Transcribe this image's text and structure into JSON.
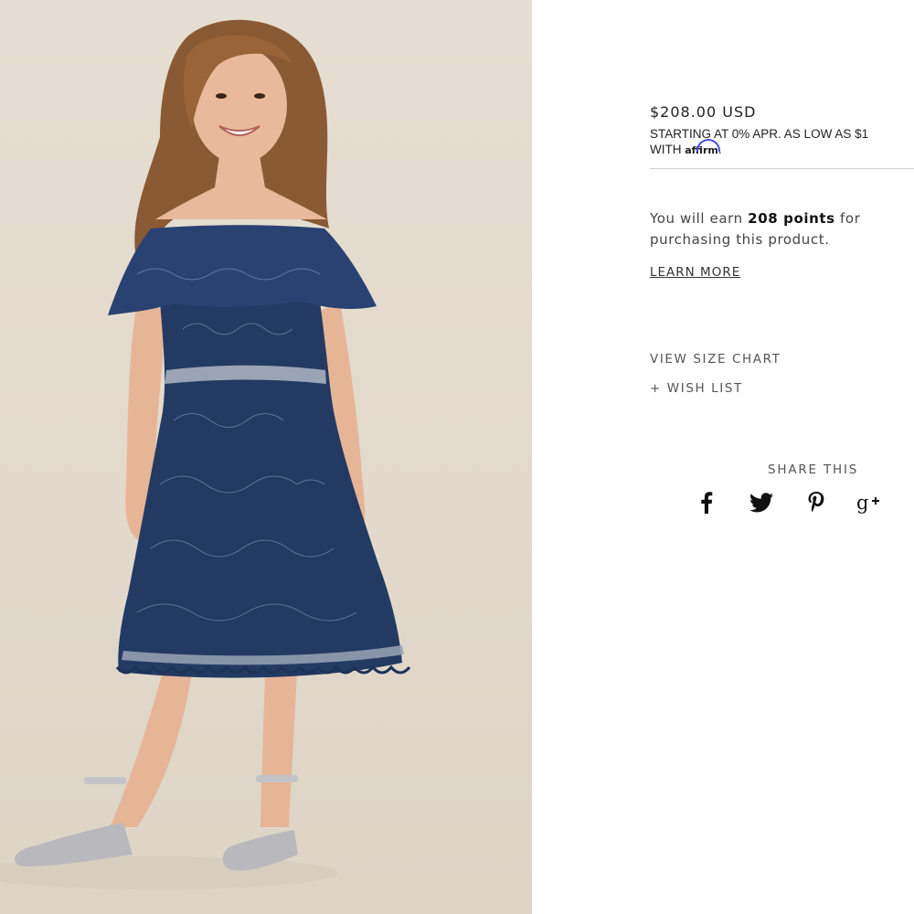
{
  "product": {
    "price": "$208.00 USD",
    "financing_line1": "STARTING AT 0% APR. AS LOW AS $1",
    "financing_prefix": "WITH ",
    "financing_brand": "affirm",
    "financing_suffix": ".",
    "points_prefix": "You will earn ",
    "points_value": "208 points",
    "points_suffix": " for purchasing this product.",
    "learn_more": "LEARN MORE",
    "view_size_chart": "VIEW SIZE CHART",
    "wish_list": "+ WISH LIST"
  },
  "share": {
    "title": "SHARE THIS",
    "icons": [
      "facebook-icon",
      "twitter-icon",
      "pinterest-icon",
      "google-plus-icon"
    ]
  },
  "colors": {
    "photo_background": "#e4dccf",
    "dress": "#233a63",
    "affirm_arc": "#4a4af4",
    "text": "#222222",
    "divider": "#cfcfcf"
  }
}
